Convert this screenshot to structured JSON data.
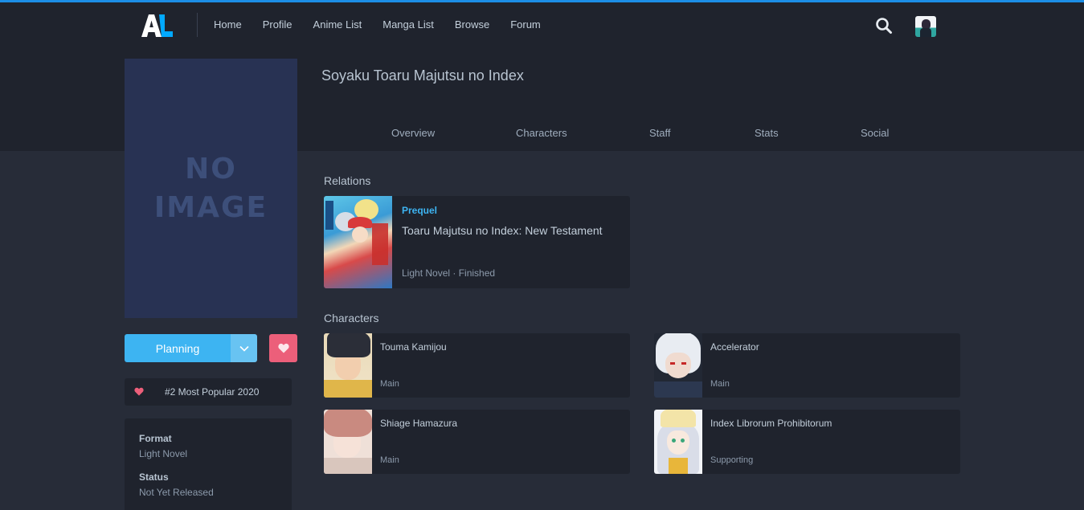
{
  "nav": {
    "logo_text": "AL",
    "links": [
      "Home",
      "Profile",
      "Anime List",
      "Manga List",
      "Browse",
      "Forum"
    ],
    "search_icon": "search-icon",
    "avatar": "user-avatar"
  },
  "media": {
    "title": "Soyaku Toaru Majutsu no Index",
    "cover_placeholder": [
      "NO",
      "IMAGE"
    ],
    "tabs": [
      "Overview",
      "Characters",
      "Staff",
      "Stats",
      "Social"
    ]
  },
  "actions": {
    "status_label": "Planning",
    "dropdown_icon": "chevron-down-icon",
    "favourite_icon": "heart-icon"
  },
  "ranking": {
    "icon": "heart-icon",
    "text": "#2 Most Popular 2020"
  },
  "info": [
    {
      "label": "Format",
      "value": "Light Novel"
    },
    {
      "label": "Status",
      "value": "Not Yet Released"
    }
  ],
  "relations": {
    "heading": "Relations",
    "items": [
      {
        "type": "Prequel",
        "title": "Toaru Majutsu no Index: New Testament",
        "meta": "Light Novel · Finished"
      }
    ]
  },
  "characters": {
    "heading": "Characters",
    "items": [
      {
        "name": "Touma Kamijou",
        "role": "Main"
      },
      {
        "name": "Accelerator",
        "role": "Main"
      },
      {
        "name": "Shiage Hamazura",
        "role": "Main"
      },
      {
        "name": "Index Librorum Prohibitorum",
        "role": "Supporting"
      }
    ]
  },
  "colors": {
    "accent": "#3db4f2",
    "favourite": "#ec5f7a",
    "background": "#272c38",
    "panel": "#1f232d"
  }
}
